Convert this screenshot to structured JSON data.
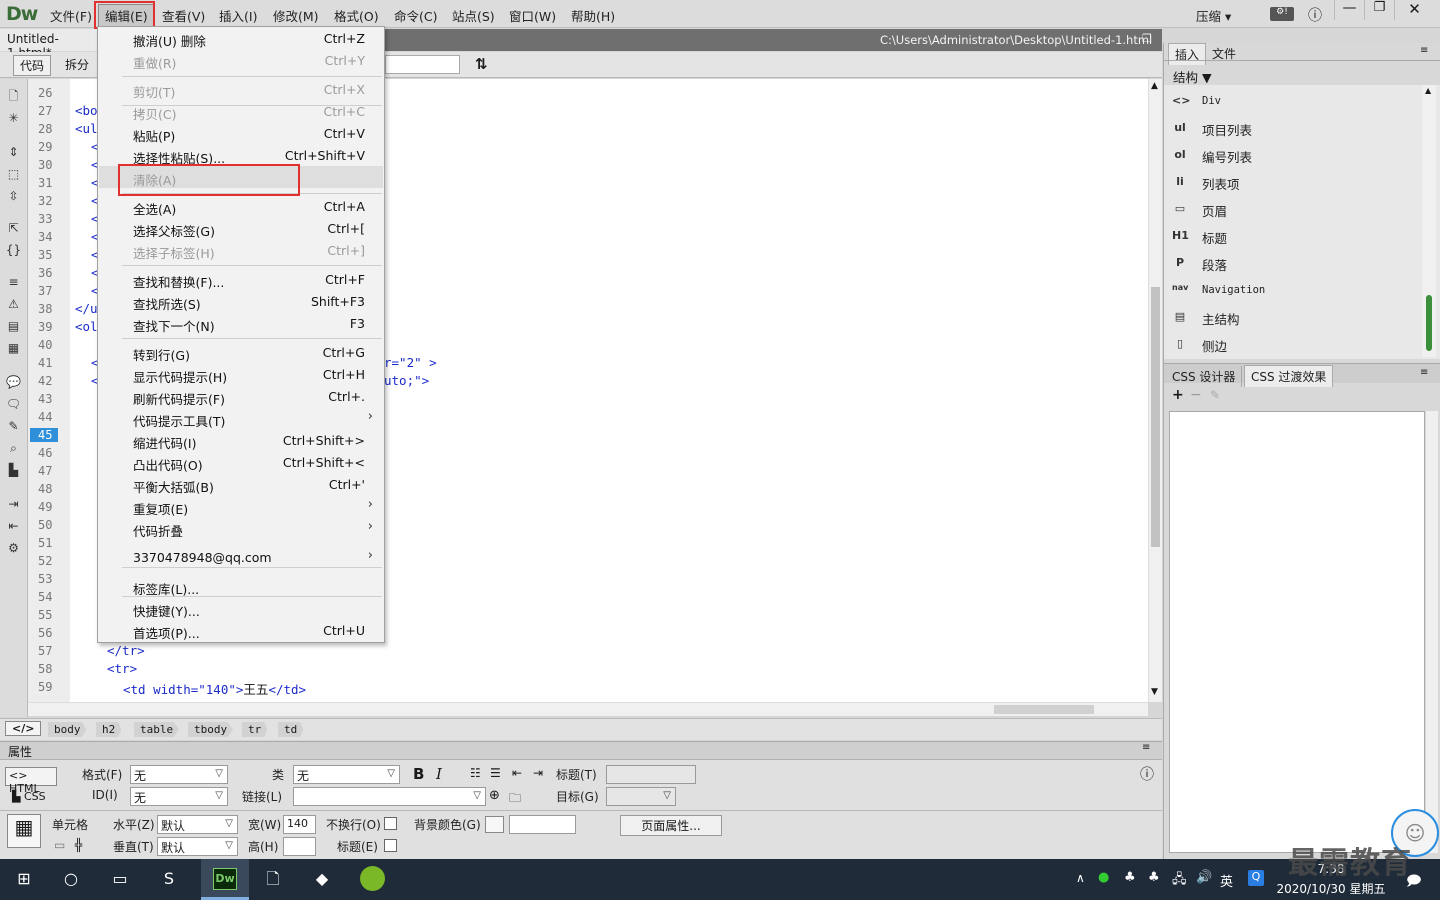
{
  "app": {
    "logo": "Dw",
    "top_right": {
      "compress": "压缩"
    }
  },
  "menubar": [
    "文件(F)",
    "编辑(E)",
    "查看(V)",
    "插入(I)",
    "修改(M)",
    "格式(O)",
    "命令(C)",
    "站点(S)",
    "窗口(W)",
    "帮助(H)"
  ],
  "document": {
    "tab": "Untitled-1.html*",
    "path": "C:\\Users\\Administrator\\Desktop\\Untitled-1.html"
  },
  "view_buttons": {
    "code": "代码",
    "split": "拆分"
  },
  "line_numbers": [
    "26",
    "27",
    "28",
    "29",
    "30",
    "31",
    "32",
    "33",
    "34",
    "35",
    "36",
    "37",
    "38",
    "39",
    "40",
    "41",
    "42",
    "43",
    "44",
    "45",
    "46",
    "47",
    "48",
    "49",
    "50",
    "51",
    "52",
    "53",
    "54",
    "55",
    "56",
    "57",
    "58",
    "59"
  ],
  "current_line": "45",
  "code": {
    "l27": "<bo",
    "l28": "<ul",
    "l29": "<",
    "l30": "<",
    "l31": "<",
    "l32": "<",
    "l33": "<",
    "l34": "<",
    "l35": "<",
    "l36": "<",
    "l37": "<",
    "l38": "</u",
    "l39": "<ol",
    "l41a": "<",
    "l41b": "r=\"2\" >",
    "l42a": "<",
    "l42b": "uto;\">",
    "l57": "</tr>",
    "l58": "<tr>",
    "l59a": "<td width=\"140\">",
    "l59b": "王五",
    "l59c": "</td>"
  },
  "edit_menu": [
    {
      "label": "撤消(U) 删除",
      "shortcut": "Ctrl+Z",
      "disabled": false
    },
    {
      "label": "重做(R)",
      "shortcut": "Ctrl+Y",
      "disabled": true
    },
    {
      "label": "剪切(T)",
      "shortcut": "Ctrl+X",
      "disabled": true
    },
    {
      "label": "拷贝(C)",
      "shortcut": "Ctrl+C",
      "disabled": true
    },
    {
      "label": "粘贴(P)",
      "shortcut": "Ctrl+V",
      "disabled": false
    },
    {
      "label": "选择性粘贴(S)...",
      "shortcut": "Ctrl+Shift+V",
      "disabled": false
    },
    {
      "label": "清除(A)",
      "shortcut": "",
      "disabled": true
    },
    {
      "label": "全选(A)",
      "shortcut": "Ctrl+A",
      "disabled": false
    },
    {
      "label": "选择父标签(G)",
      "shortcut": "Ctrl+[",
      "disabled": false
    },
    {
      "label": "选择子标签(H)",
      "shortcut": "Ctrl+]",
      "disabled": true
    },
    {
      "label": "查找和替换(F)...",
      "shortcut": "Ctrl+F",
      "disabled": false
    },
    {
      "label": "查找所选(S)",
      "shortcut": "Shift+F3",
      "disabled": false
    },
    {
      "label": "查找下一个(N)",
      "shortcut": "F3",
      "disabled": false
    },
    {
      "label": "转到行(G)",
      "shortcut": "Ctrl+G",
      "disabled": false
    },
    {
      "label": "显示代码提示(H)",
      "shortcut": "Ctrl+H",
      "disabled": false
    },
    {
      "label": "刷新代码提示(F)",
      "shortcut": "Ctrl+.",
      "disabled": false
    },
    {
      "label": "代码提示工具(T)",
      "shortcut": "",
      "disabled": false
    },
    {
      "label": "缩进代码(I)",
      "shortcut": "Ctrl+Shift+>",
      "disabled": false
    },
    {
      "label": "凸出代码(O)",
      "shortcut": "Ctrl+Shift+<",
      "disabled": false
    },
    {
      "label": "平衡大括弧(B)",
      "shortcut": "Ctrl+'",
      "disabled": false
    },
    {
      "label": "重复项(E)",
      "shortcut": "",
      "disabled": false
    },
    {
      "label": "代码折叠",
      "shortcut": "",
      "disabled": false
    },
    {
      "label": "3370478948@qq.com",
      "shortcut": "",
      "disabled": false
    },
    {
      "label": "标签库(L)...",
      "shortcut": "",
      "disabled": false
    },
    {
      "label": "快捷键(Y)...",
      "shortcut": "",
      "disabled": false
    },
    {
      "label": "首选项(P)...",
      "shortcut": "Ctrl+U",
      "disabled": false
    }
  ],
  "tag_selector": [
    "body",
    "h2",
    "table",
    "tbody",
    "tr",
    "td"
  ],
  "properties": {
    "title": "属性",
    "html": "HTML",
    "css": "CSS",
    "format_label": "格式(F)",
    "format_value": "无",
    "class_label": "类",
    "class_value": "无",
    "id_label": "ID(I)",
    "id_value": "无",
    "link_label": "链接(L)",
    "title_label": "标题(T)",
    "target_label": "目标(G)",
    "cell": "单元格",
    "horz_label": "水平(Z)",
    "horz_value": "默认",
    "vert_label": "垂直(T)",
    "vert_value": "默认",
    "width_label": "宽(W)",
    "width_value": "140",
    "height_label": "高(H)",
    "nowrap_label": "不换行(O)",
    "header_label": "标题(E)",
    "bg_label": "背景颜色(G)",
    "page_props": "页面属性..."
  },
  "insert_panel": {
    "tabs": [
      "插入",
      "文件"
    ],
    "category": "结构",
    "items": [
      {
        "icon": "<>",
        "label": "Div"
      },
      {
        "icon": "ul",
        "label": "项目列表"
      },
      {
        "icon": "ol",
        "label": "编号列表"
      },
      {
        "icon": "li",
        "label": "列表项"
      },
      {
        "icon": "▭",
        "label": "页眉"
      },
      {
        "icon": "H1",
        "label": "标题"
      },
      {
        "icon": "P",
        "label": "段落"
      },
      {
        "icon": "nav",
        "label": "Navigation"
      },
      {
        "icon": "▤",
        "label": "主结构"
      },
      {
        "icon": "▯",
        "label": "侧边"
      }
    ]
  },
  "css_panel": {
    "tabs": [
      "CSS 设计器",
      "CSS 过渡效果"
    ]
  },
  "taskbar": {
    "time": "7:38",
    "date": "2020/10/30 星期五",
    "ime": "英"
  },
  "watermark": "最需教育",
  "colors": {
    "accent": "#2f8fd9",
    "highlight": "#e03030",
    "taskbar": "#1f2b39"
  }
}
